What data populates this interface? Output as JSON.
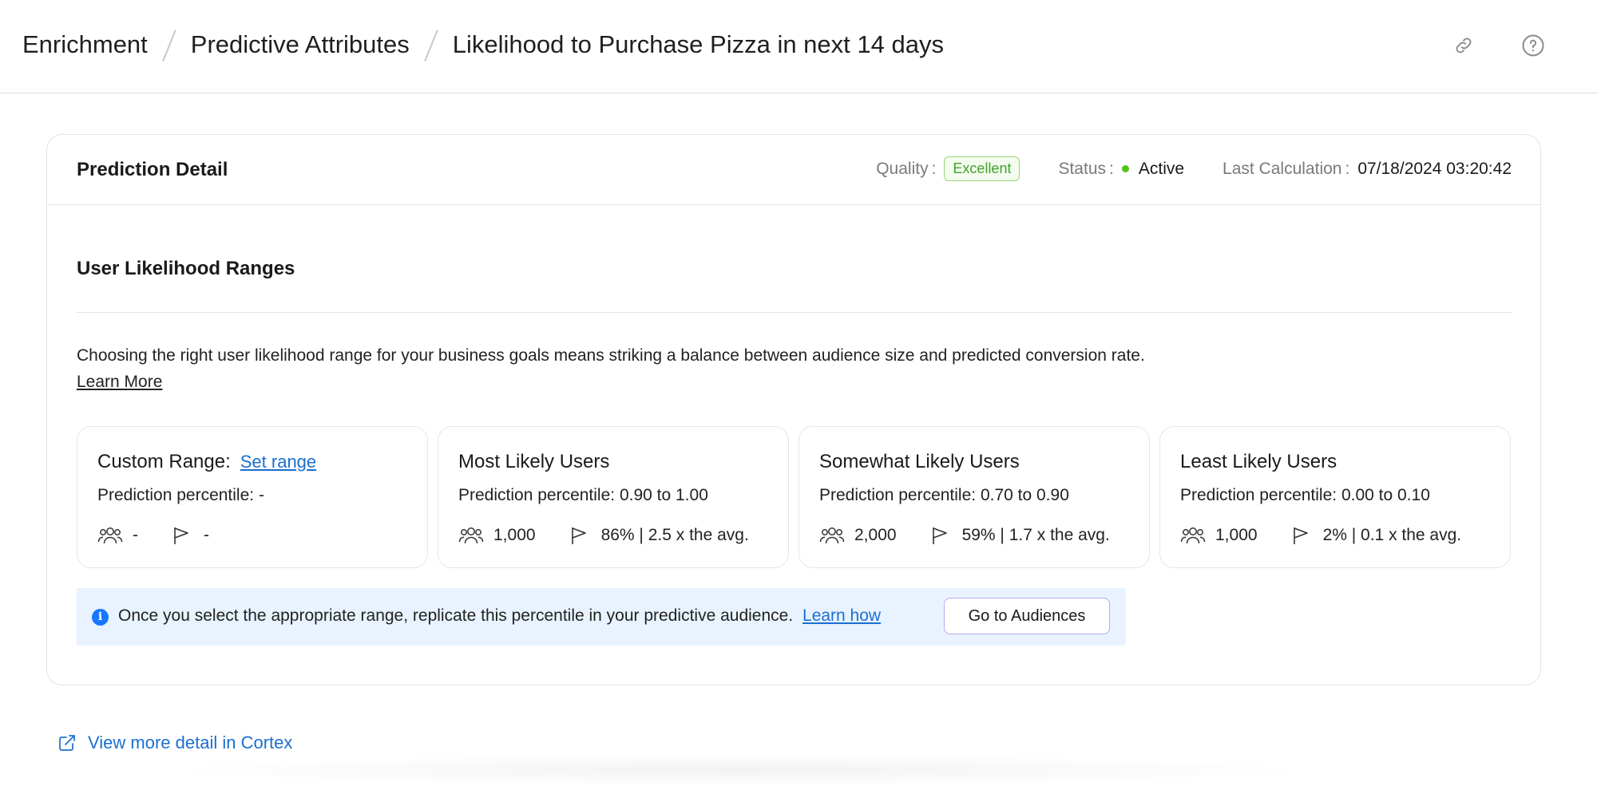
{
  "breadcrumb": {
    "items": [
      "Enrichment",
      "Predictive Attributes",
      "Likelihood to Purchase Pizza in next 14 days"
    ]
  },
  "header_icons": {
    "link": "link-icon",
    "help": "help-icon"
  },
  "prediction": {
    "title": "Prediction Detail",
    "quality_label": "Quality",
    "quality_value": "Excellent",
    "status_label": "Status",
    "status_value": "Active",
    "last_calc_label": "Last Calculation",
    "last_calc_value": "07/18/2024 03:20:42",
    "colors": {
      "excellent": "#3fa32a",
      "active_dot": "#52c41a"
    }
  },
  "ranges": {
    "title": "User Likelihood Ranges",
    "description": "Choosing the right user likelihood range for your business goals means striking a balance between audience size and predicted conversion rate.",
    "learn_more": "Learn More",
    "cards": [
      {
        "title": "Custom Range:",
        "link": "Set range",
        "percentile": "Prediction percentile: -",
        "users": "-",
        "conversion": "-"
      },
      {
        "title": "Most Likely Users",
        "percentile": "Prediction percentile: 0.90 to 1.00",
        "users": "1,000",
        "conversion": "86% | 2.5 x the avg."
      },
      {
        "title": "Somewhat Likely Users",
        "percentile": "Prediction percentile: 0.70 to 0.90",
        "users": "2,000",
        "conversion": "59% | 1.7 x the avg."
      },
      {
        "title": "Least Likely Users",
        "percentile": "Prediction percentile: 0.00 to 0.10",
        "users": "1,000",
        "conversion": "2% | 0.1 x the avg."
      }
    ]
  },
  "info": {
    "text": "Once you select the appropriate range, replicate this percentile in your predictive audience.",
    "link": "Learn how",
    "button": "Go to Audiences",
    "color": "#1677ff"
  },
  "footer": {
    "cortex_link": "View more detail in Cortex"
  }
}
